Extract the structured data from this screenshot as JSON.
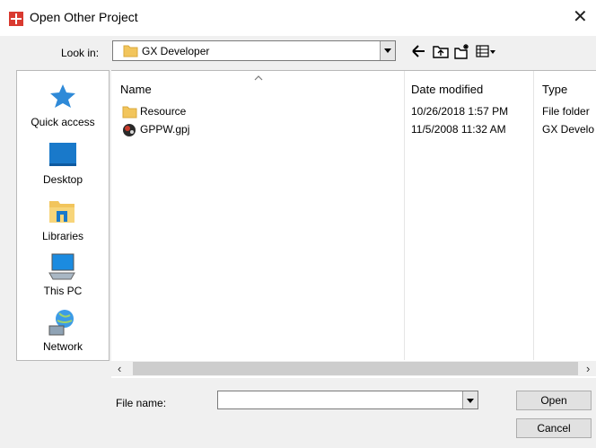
{
  "window": {
    "title": "Open Other Project"
  },
  "look_in": {
    "label": "Look in:",
    "value": "GX Developer"
  },
  "places": [
    {
      "label": "Quick access",
      "icon": "quick-access-star-icon"
    },
    {
      "label": "Desktop",
      "icon": "desktop-icon"
    },
    {
      "label": "Libraries",
      "icon": "libraries-icon"
    },
    {
      "label": "This PC",
      "icon": "this-pc-icon"
    },
    {
      "label": "Network",
      "icon": "network-icon"
    }
  ],
  "columns": {
    "name": "Name",
    "date": "Date modified",
    "type": "Type"
  },
  "files": [
    {
      "name": "Resource",
      "date": "10/26/2018 1:57 PM",
      "type": "File folder",
      "icon": "folder-icon"
    },
    {
      "name": "GPPW.gpj",
      "date": "11/5/2008 11:32 AM",
      "type": "GX Develo",
      "icon": "gx-project-file-icon"
    }
  ],
  "file_name": {
    "label": "File name:",
    "value": ""
  },
  "buttons": {
    "open": "Open",
    "cancel": "Cancel"
  },
  "colors": {
    "folder": "#f2c55c",
    "accent": "#1979ca",
    "app_icon": "#d93a30"
  }
}
